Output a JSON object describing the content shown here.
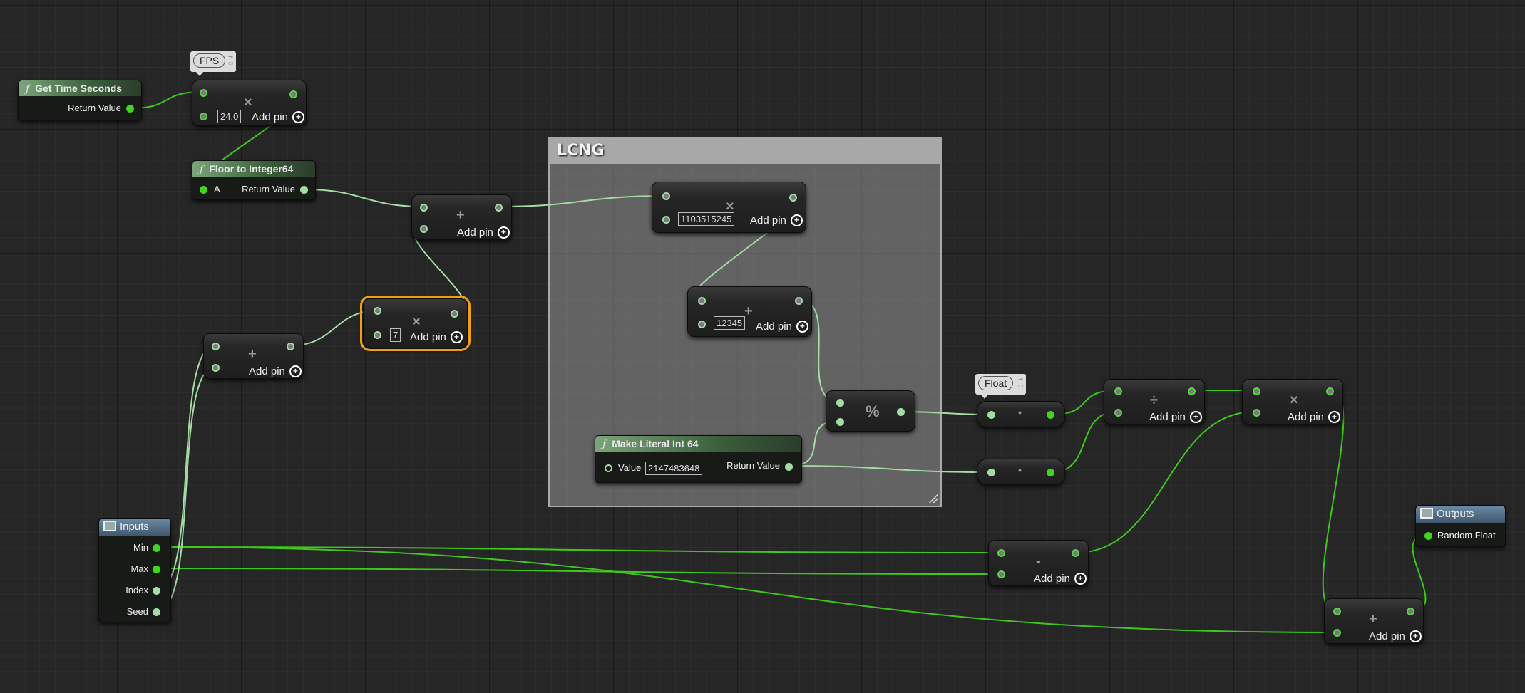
{
  "comment": {
    "title": "LCNG"
  },
  "bubbles": {
    "fps": "FPS",
    "float": "Float"
  },
  "nodes": {
    "get_time": {
      "title": "Get Time Seconds",
      "fn_glyph": "ƒ",
      "pins": {
        "return": "Return Value"
      }
    },
    "fps_mult": {
      "op": "×",
      "value": "24.0",
      "add_pin": "Add pin"
    },
    "floor": {
      "title": "Floor to Integer64",
      "fn_glyph": "ƒ",
      "pins": {
        "a": "A",
        "return": "Return Value"
      }
    },
    "add1": {
      "op": "+",
      "add_pin": "Add pin"
    },
    "mult7": {
      "op": "×",
      "value": "7",
      "add_pin": "Add pin"
    },
    "add2": {
      "op": "+",
      "add_pin": "Add pin"
    },
    "mult_lcg": {
      "op": "×",
      "value": "1103515245",
      "add_pin": "Add pin"
    },
    "add_lcg": {
      "op": "+",
      "value": "12345",
      "add_pin": "Add pin"
    },
    "modulo": {
      "op": "%"
    },
    "make_literal": {
      "title": "Make Literal Int 64",
      "fn_glyph": "ƒ",
      "pins": {
        "value": "Value",
        "return": "Return Value"
      },
      "value": "2147483648"
    },
    "conv1": {
      "op": "•"
    },
    "conv2": {
      "op": "•"
    },
    "divide": {
      "op": "÷",
      "add_pin": "Add pin"
    },
    "mult_range": {
      "op": "×",
      "add_pin": "Add pin"
    },
    "subtract": {
      "op": "-",
      "add_pin": "Add pin"
    },
    "add_min": {
      "op": "+",
      "add_pin": "Add pin"
    },
    "inputs": {
      "title": "Inputs",
      "pins": [
        "Min",
        "Max",
        "Index",
        "Seed"
      ]
    },
    "outputs": {
      "title": "Outputs",
      "pins": [
        "Random Float"
      ]
    }
  },
  "colors": {
    "float_wire": "#3fc81c",
    "int64_wire": "#a5dba5",
    "selection": "#f0a018"
  }
}
